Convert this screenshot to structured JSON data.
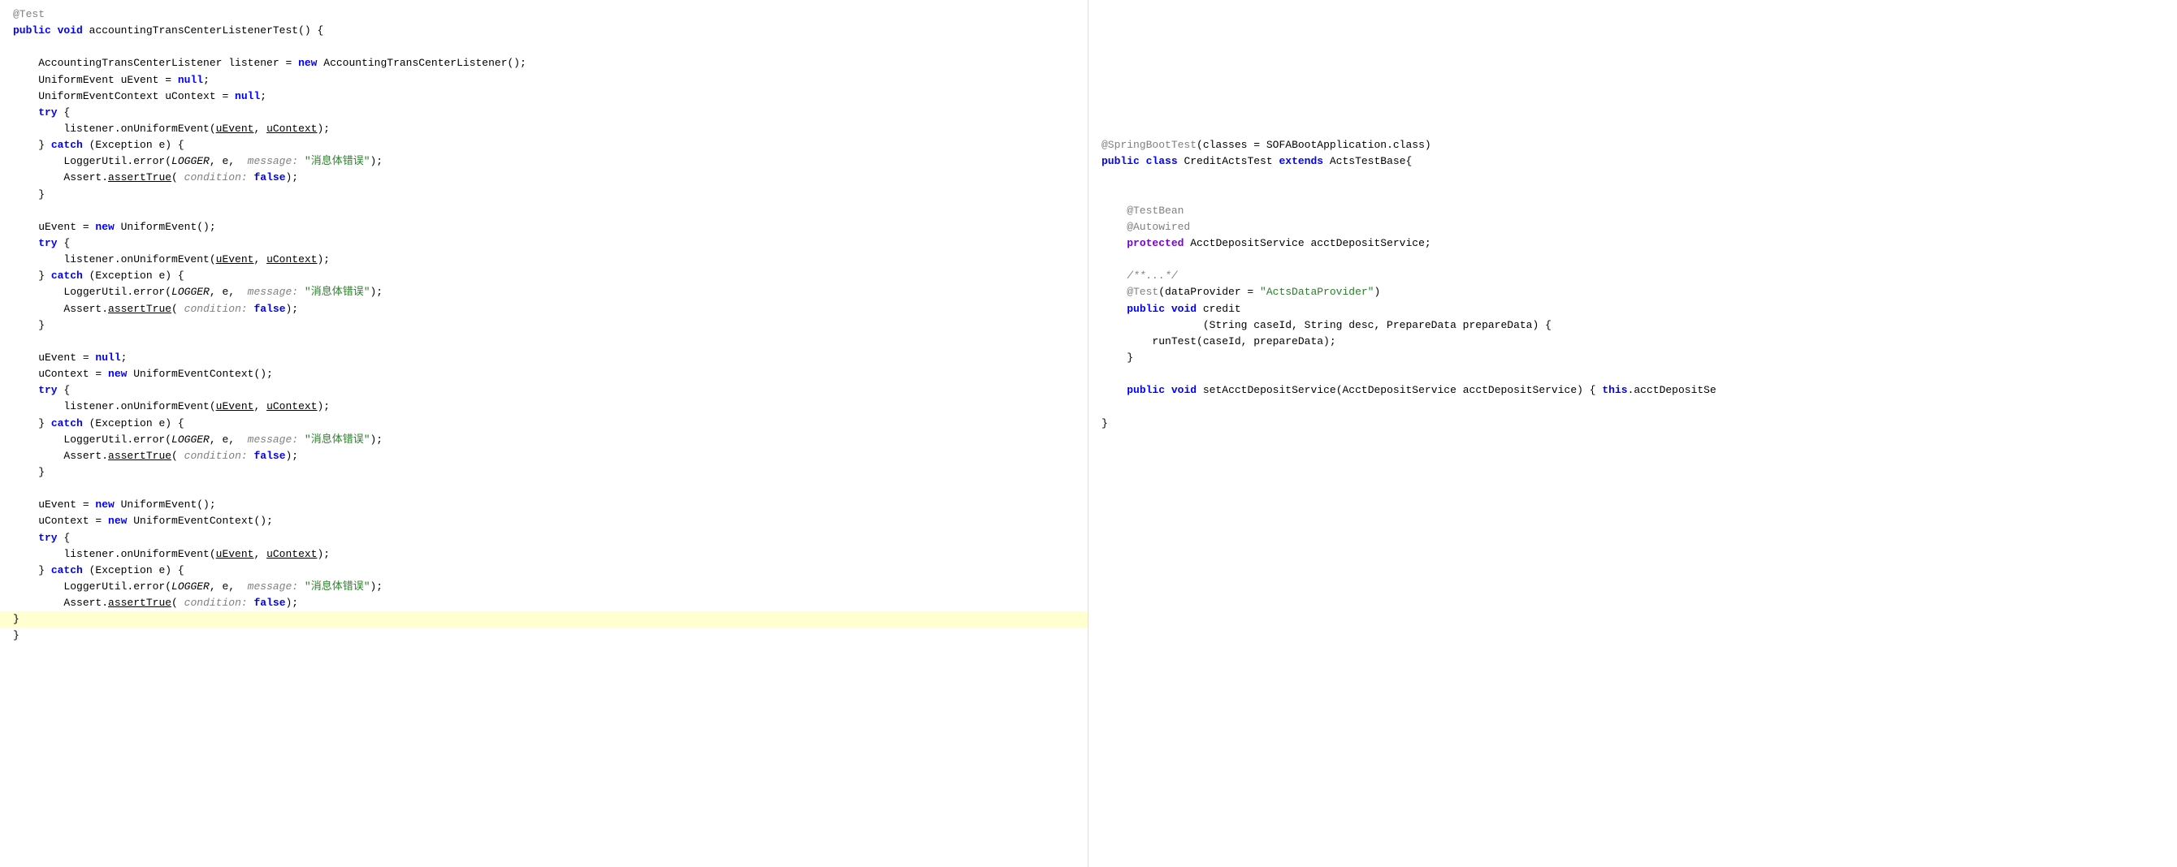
{
  "colors": {
    "keyword": "#0000ff",
    "keyword_bold": "#0000ff",
    "annotation": "#808080",
    "string": "#2a7f2a",
    "comment": "#808080",
    "purple": "#7b00d4",
    "bg_highlight": "#ffffd0",
    "bg_normal": "#ffffff"
  },
  "left_pane": {
    "lines": [
      "@Test",
      "public void accountingTransCenterListenerTest() {",
      "",
      "    AccountingTransCenterListener listener = new AccountingTransCenterListener();",
      "    UniformEvent uEvent = null;",
      "    UniformEventContext uContext = null;",
      "    try {",
      "        listener.onUniformEvent(uEvent, uContext);",
      "    } catch (Exception e) {",
      "        LoggerUtil.error(LOGGER, e,  message: \"消息体错误\");",
      "        Assert.assertTrue( condition: false);",
      "    }",
      "",
      "    uEvent = new UniformEvent();",
      "    try {",
      "        listener.onUniformEvent(uEvent, uContext);",
      "    } catch (Exception e) {",
      "        LoggerUtil.error(LOGGER, e,  message: \"消息体错误\");",
      "        Assert.assertTrue( condition: false);",
      "    }",
      "",
      "    uEvent = null;",
      "    uContext = new UniformEventContext();",
      "    try {",
      "        listener.onUniformEvent(uEvent, uContext);",
      "    } catch (Exception e) {",
      "        LoggerUtil.error(LOGGER, e,  message: \"消息体错误\");",
      "        Assert.assertTrue( condition: false);",
      "    }",
      "",
      "    uEvent = new UniformEvent();",
      "    uContext = new UniformEventContext();",
      "    try {",
      "        listener.onUniformEvent(uEvent, uContext);",
      "    } catch (Exception e) {",
      "        LoggerUtil.error(LOGGER, e,  message: \"消息体错误\");",
      "        Assert.assertTrue( condition: false);",
      "    }",
      "}",
      "}"
    ]
  },
  "right_pane": {
    "lines": [
      "",
      "",
      "",
      "",
      "",
      "",
      "",
      "",
      "@SpringBootTest(classes = SOFABootApplication.class)",
      "public class CreditActsTest extends ActsTestBase{",
      "",
      "",
      "    @TestBean",
      "    @Autowired",
      "    protected AcctDepositService acctDepositService;",
      "",
      "    /**...*/",
      "    @Test(dataProvider = \"ActsDataProvider\")",
      "    public void credit",
      "                (String caseId, String desc, PrepareData prepareData) {",
      "        runTest(caseId, prepareData);",
      "    }",
      "",
      "    public void setAcctDepositService(AcctDepositService acctDepositService) { this.acctDepositSe",
      "",
      "}"
    ]
  }
}
